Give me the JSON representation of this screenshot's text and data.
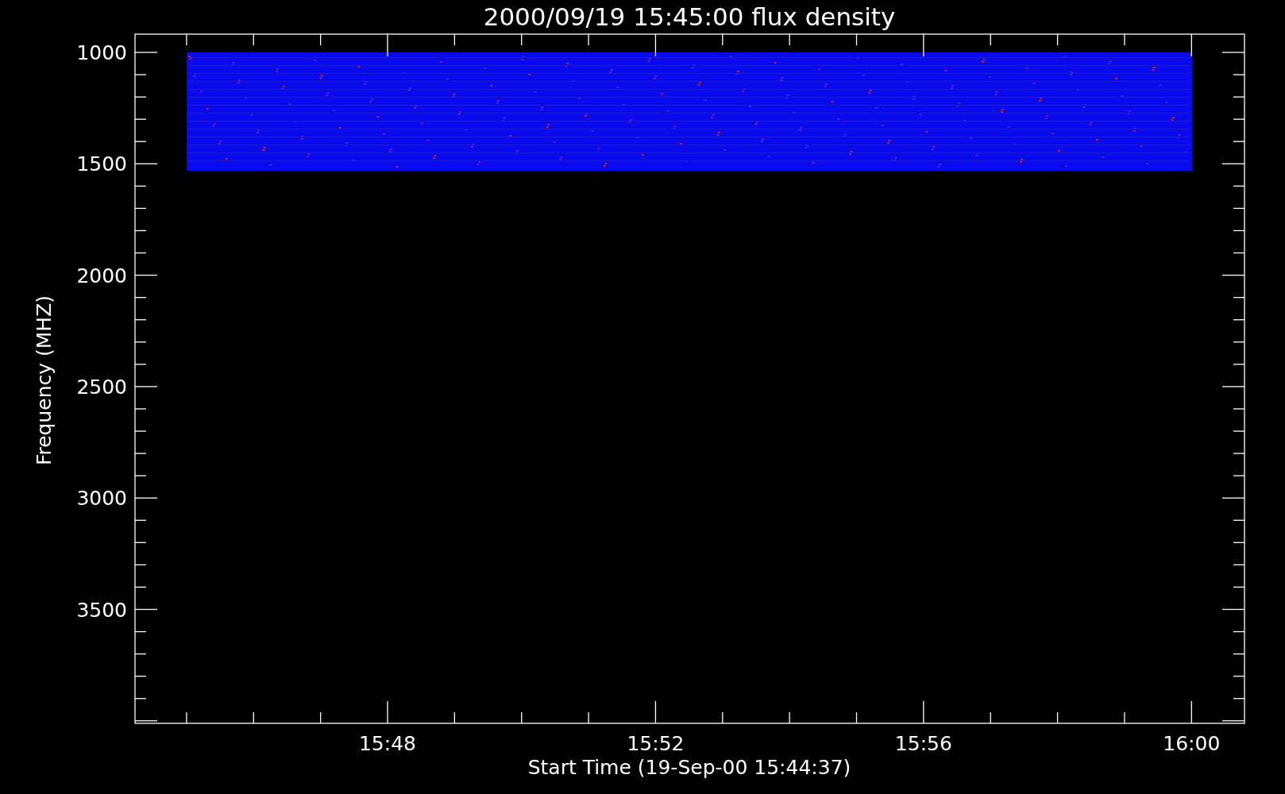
{
  "title": "2000/09/19 15:45:00 flux density",
  "ylabel": "Frequency (MHZ)",
  "xlabel": "Start Time (19-Sep-00 15:44:37)",
  "yticks": [
    "1000",
    "1500",
    "2000",
    "2500",
    "3000",
    "3500"
  ],
  "xticks": [
    "15:48",
    "15:52",
    "15:56",
    "16:00"
  ]
}
